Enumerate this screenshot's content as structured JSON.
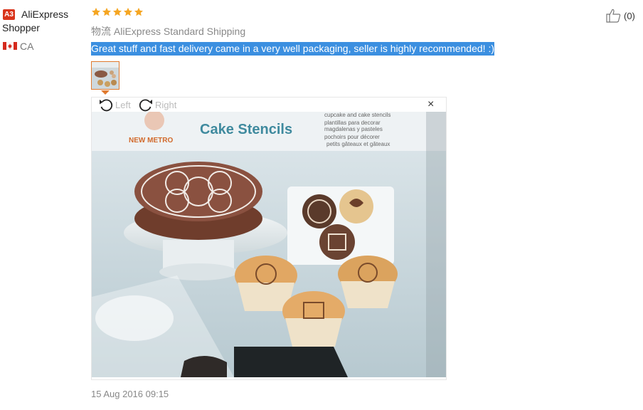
{
  "reviewer": {
    "badge": "A3",
    "name_line1": "AliExpress",
    "name_line2": "Shopper",
    "country": "CA"
  },
  "review": {
    "rating": 5,
    "shipping": "物流 AliExpress Standard Shipping",
    "text": "Great stuff and fast delivery came in a very well packaging, seller is highly recommended! :)",
    "date": "15 Aug 2016 09:15",
    "helpful_count": "(0)"
  },
  "viewer": {
    "rotate_left_label": "Left",
    "rotate_right_label": "Right",
    "close_label": "×"
  },
  "photo": {
    "brand": "NEW METRO",
    "title": "Cake Stencils",
    "subtitle_lines": [
      "cupcake and cake stencils",
      "plantillas para decorar",
      "magdalenas y pasteles",
      "pochoirs pour décorer",
      "petits gâteaux et gâteaux"
    ]
  },
  "colors": {
    "badge": "#d9341b",
    "star": "#f5a623",
    "highlight": "#3b8fe0",
    "thumb_border": "#e07a2f"
  },
  "icons": [
    "star-icon",
    "canada-flag-icon",
    "rotate-left-icon",
    "rotate-right-icon",
    "close-icon",
    "thumbs-up-icon"
  ]
}
